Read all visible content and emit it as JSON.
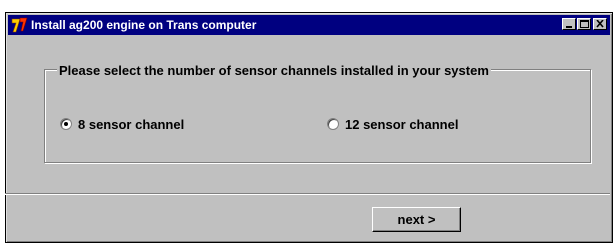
{
  "window": {
    "title": "Install ag200 engine on Trans computer",
    "icon": "app-logo-icon",
    "controls": [
      "minimize-icon",
      "maximize-icon",
      "close-icon"
    ]
  },
  "group": {
    "legend": "Please select the number of sensor channels installed in your system",
    "options": [
      {
        "label": "8 sensor channel",
        "selected": true
      },
      {
        "label": "12 sensor channel",
        "selected": false
      }
    ]
  },
  "footer": {
    "next_label": "next >"
  },
  "colors": {
    "titlebar": "#000080",
    "face": "#c0c0c0"
  }
}
